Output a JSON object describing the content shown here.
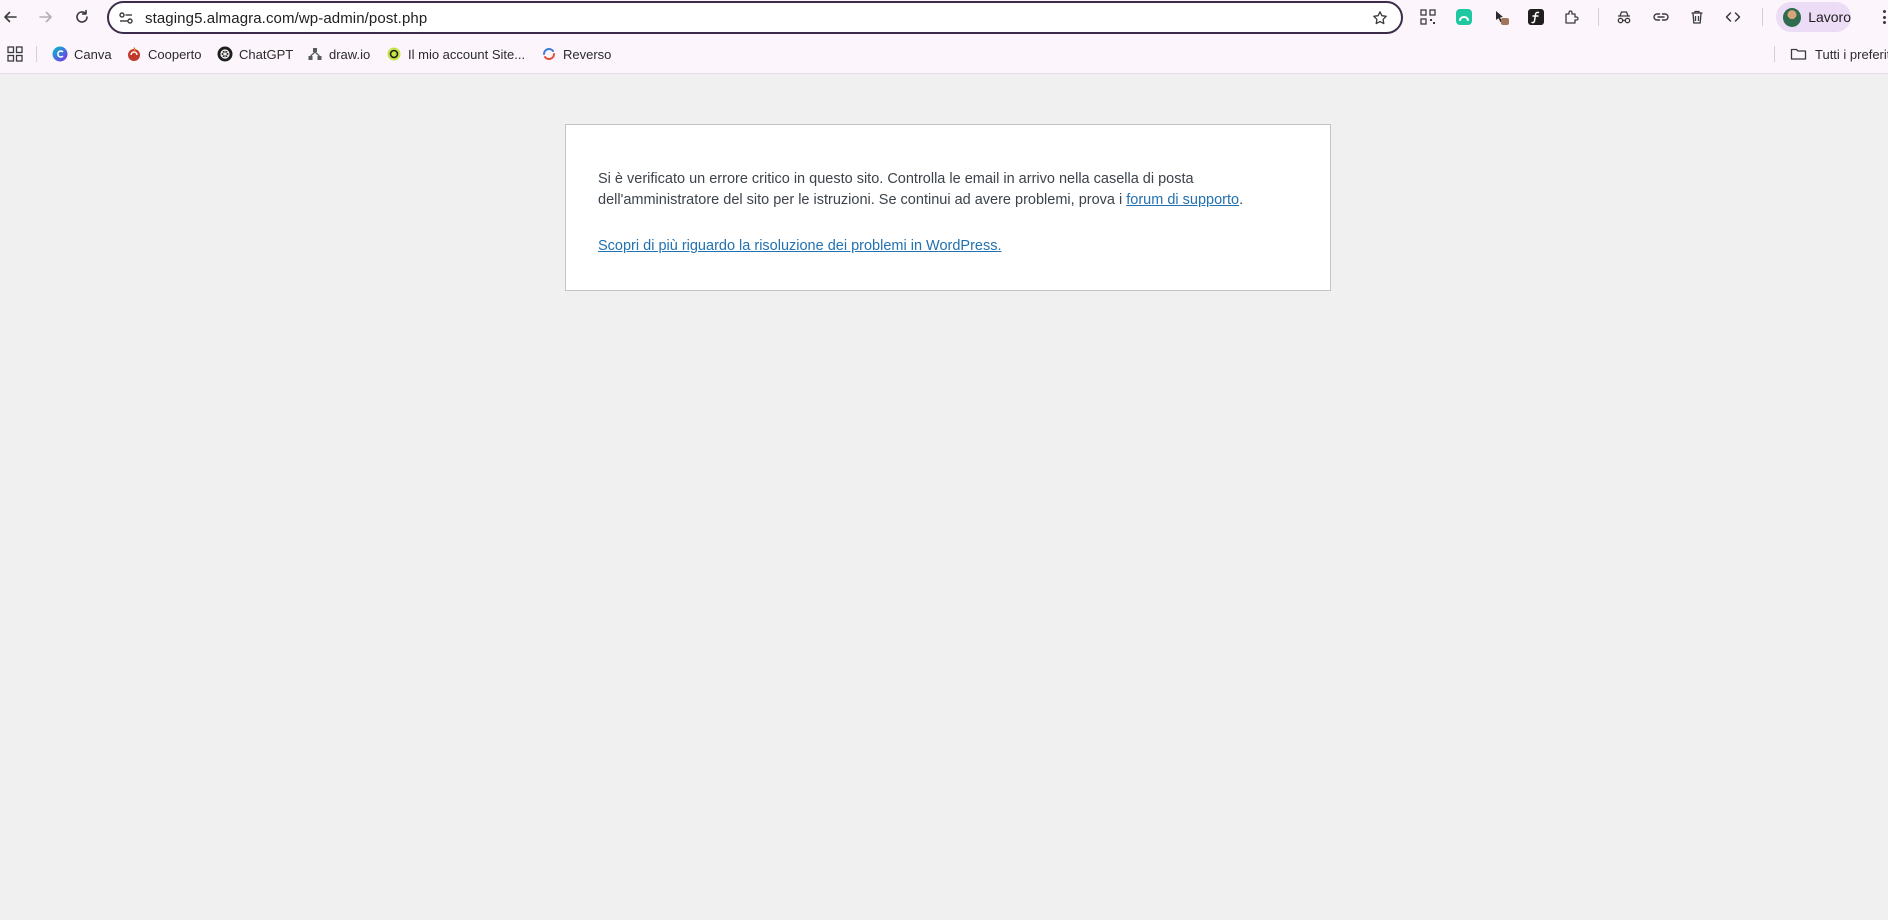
{
  "browser": {
    "url": "staging5.almagra.com/wp-admin/post.php",
    "profile_name": "Lavoro",
    "toolbar_icons": [
      "back-icon",
      "forward-icon",
      "reload-icon",
      "site-info-icon",
      "bookmark-star-icon",
      "qr-code-icon",
      "extension-green-icon",
      "extension-cursor-icon",
      "extension-f-icon",
      "puzzle-icon",
      "incognito-icon",
      "link-icon",
      "trash-icon",
      "code-icon",
      "menu-dots-icon"
    ]
  },
  "bookmarks": {
    "items": [
      {
        "label": "Canva",
        "icon": "canva-icon"
      },
      {
        "label": "Cooperto",
        "icon": "cooperto-icon"
      },
      {
        "label": "ChatGPT",
        "icon": "chatgpt-icon"
      },
      {
        "label": "draw.io",
        "icon": "drawio-icon"
      },
      {
        "label": "Il mio account Site...",
        "icon": "account-icon"
      },
      {
        "label": "Reverso",
        "icon": "reverso-icon"
      }
    ],
    "all_bookmarks_label": "Tutti i preferiti"
  },
  "error": {
    "message_before_link": "Si è verificato un errore critico in questo sito. Controlla le email in arrivo nella casella di posta dell'amministratore del sito per le istruzioni. Se continui ad avere problemi, prova i ",
    "support_link_text": "forum di supporto",
    "message_after_link": ".",
    "learn_more_link": "Scopri di più riguardo la risoluzione dei problemi in WordPress."
  },
  "colors": {
    "page_background": "#f0f0f1",
    "link": "#2271b1",
    "text": "#3c434a",
    "chrome_bar": "#fcf6fc"
  }
}
